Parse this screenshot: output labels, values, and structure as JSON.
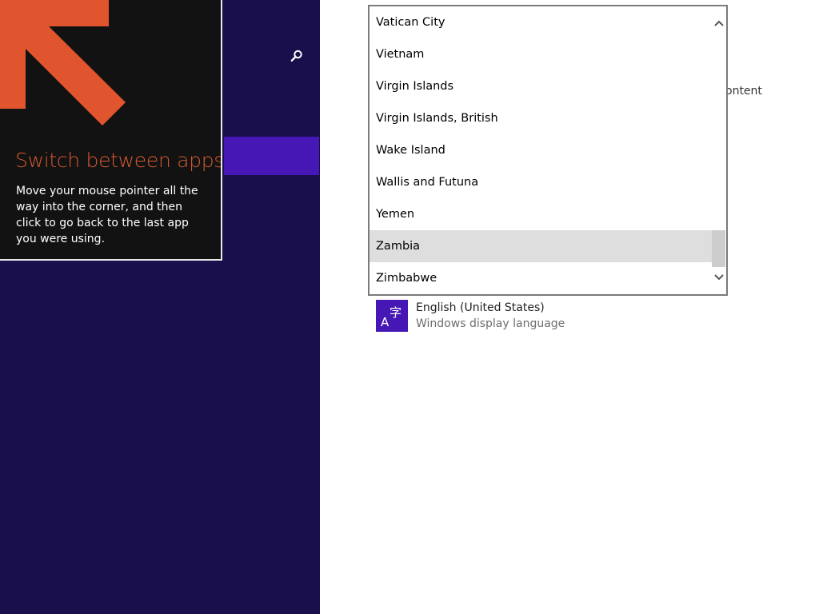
{
  "tip": {
    "title": "Switch between apps",
    "body": "Move your mouse pointer all the way into the corner, and then click to go back to the last app you were using.",
    "arrow_icon": "arrow-up-left-icon",
    "title_color": "#d35930"
  },
  "sidebar": {
    "search_icon": "search-icon",
    "accent_color": "#4617b4",
    "background_color": "#180f4c"
  },
  "main": {
    "partial_text": "ontent"
  },
  "country_dropdown": {
    "items": [
      "Vatican City",
      "Vietnam",
      "Virgin Islands",
      "Virgin Islands, British",
      "Wake Island",
      "Wallis and Futuna",
      "Yemen",
      "Zambia",
      "Zimbabwe"
    ],
    "selected": "Zambia"
  },
  "languages": [
    {
      "name": "English (United States)",
      "subtitle": "Windows display language",
      "icon": "language-icon"
    }
  ]
}
